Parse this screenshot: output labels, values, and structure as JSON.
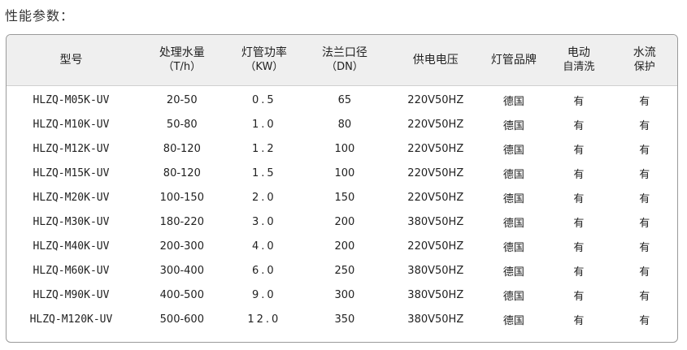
{
  "section_title": "性能参数：",
  "headers": [
    {
      "main": "型号",
      "sub": ""
    },
    {
      "main": "处理水量",
      "sub": "（T/h）"
    },
    {
      "main": "灯管功率",
      "sub": "（KW）"
    },
    {
      "main": "法兰口径",
      "sub": "（DN）"
    },
    {
      "main": "供电电压",
      "sub": ""
    },
    {
      "main": "灯管品牌",
      "sub": ""
    },
    {
      "main": "电动",
      "sub": "自清洗"
    },
    {
      "main": "水流",
      "sub": "保护"
    }
  ],
  "rows": [
    [
      "HLZQ-M05K-UV",
      "20-50",
      "0.5",
      "65",
      "220V50HZ",
      "德国",
      "有",
      "有"
    ],
    [
      "HLZQ-M10K-UV",
      "50-80",
      "1.0",
      "80",
      "220V50HZ",
      "德国",
      "有",
      "有"
    ],
    [
      "HLZQ-M12K-UV",
      "80-120",
      "1.2",
      "100",
      "220V50HZ",
      "德国",
      "有",
      "有"
    ],
    [
      "HLZQ-M15K-UV",
      "80-120",
      "1.5",
      "100",
      "220V50HZ",
      "德国",
      "有",
      "有"
    ],
    [
      "HLZQ-M20K-UV",
      "100-150",
      "2.0",
      "150",
      "220V50HZ",
      "德国",
      "有",
      "有"
    ],
    [
      "HLZQ-M30K-UV",
      "180-220",
      "3.0",
      "200",
      "380V50HZ",
      "德国",
      "有",
      "有"
    ],
    [
      "HLZQ-M40K-UV",
      "200-300",
      "4.0",
      "200",
      "220V50HZ",
      "德国",
      "有",
      "有"
    ],
    [
      "HLZQ-M60K-UV",
      "300-400",
      "6.0",
      "250",
      "380V50HZ",
      "德国",
      "有",
      "有"
    ],
    [
      "HLZQ-M90K-UV",
      "400-500",
      "9.0",
      "300",
      "380V50HZ",
      "德国",
      "有",
      "有"
    ],
    [
      "HLZQ-M120K-UV",
      "500-600",
      "12.0",
      "350",
      "380V50HZ",
      "德国",
      "有",
      "有"
    ]
  ]
}
